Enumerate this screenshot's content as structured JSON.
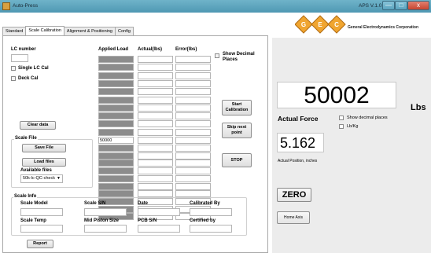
{
  "window": {
    "title": "Auto-Press",
    "version": "APS V.1.0.1",
    "minimize_glyph": "—",
    "maximize_glyph": "□",
    "close_glyph": "x"
  },
  "tabs": [
    {
      "label": "Standard",
      "active": false
    },
    {
      "label": "Scale Calibration",
      "active": true
    },
    {
      "label": "Alignment & Positioning",
      "active": false
    },
    {
      "label": "Config",
      "active": false
    }
  ],
  "brand": {
    "logo_letters": [
      "G",
      "E",
      "C"
    ],
    "corporation": "General Electrodynamics Corporation",
    "colors": {
      "diamond_fill": "#f0a530",
      "diamond_stroke": "#b06a10"
    }
  },
  "calibration": {
    "lc_number_label": "LC number",
    "lc_number_value": "",
    "single_lc_label": "Single LC Cal",
    "single_lc_checked": false,
    "deck_cal_label": "Deck Cal",
    "deck_cal_checked": false,
    "columns": {
      "applied": "Applied Load",
      "actual": "Actual(lbs)",
      "error": "Error(lbs)"
    },
    "applied_loads": [
      "",
      "",
      "",
      "",
      "",
      "",
      "",
      "",
      "",
      "",
      "50000",
      "",
      "",
      "",
      "",
      "",
      "",
      "",
      "",
      "",
      ""
    ],
    "show_decimal_label": "Show Decimal Places",
    "show_decimal_checked": false,
    "start_button": "Start Calibration",
    "skip_button": "Skip next point",
    "stop_button": "STOP",
    "clear_button": "Clear data"
  },
  "scale_file": {
    "title": "Scale File",
    "save_button": "Save File",
    "load_button": "Load files",
    "available_label": "Available files",
    "selected_file": "50k-lc-QC-check",
    "arrow_glyph": "▼"
  },
  "scale_info": {
    "title": "Scale Info",
    "fields": [
      {
        "label": "Scale Model",
        "value": ""
      },
      {
        "label": "Scale S/N",
        "value": ""
      },
      {
        "label": "Date",
        "value": ""
      },
      {
        "label": "Calibrated By",
        "value": ""
      },
      {
        "label": "Scale Temp",
        "value": ""
      },
      {
        "label": "Mid Piston Size",
        "value": ""
      },
      {
        "label": "PCB S/N",
        "value": ""
      },
      {
        "label": "Certified by",
        "value": ""
      }
    ],
    "report_button": "Report"
  },
  "readout": {
    "force_value": "50002",
    "force_unit": "Lbs",
    "force_label": "Actual Force",
    "show_decimal_label": "Show decimal places",
    "show_decimal_checked": false,
    "lbkg_label": "Lb/Kg",
    "lbkg_checked": false,
    "position_value": "5.162",
    "position_label": "Actual Position, inches",
    "zero_button": "ZERO",
    "home_button": "Home Axis"
  }
}
